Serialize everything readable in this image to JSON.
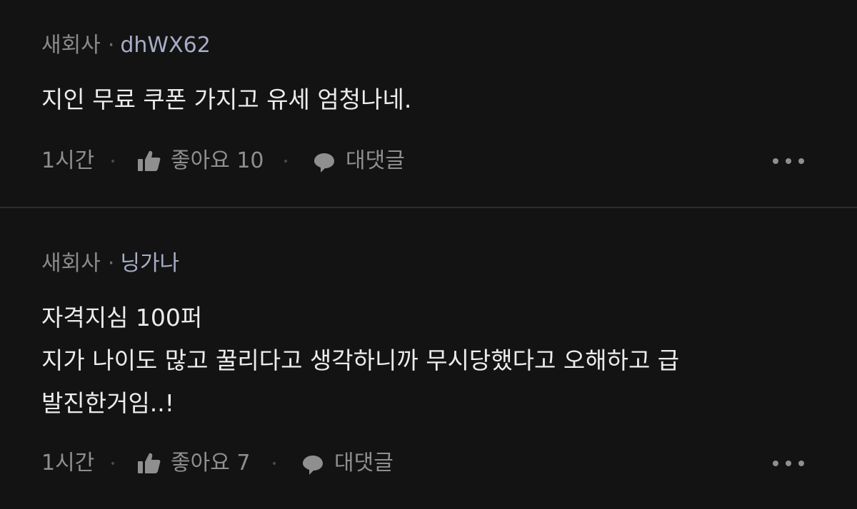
{
  "comments": [
    {
      "company": "새회사",
      "author": "dhWX62",
      "text_lines": [
        "지인 무료 쿠폰 가지고 유세 엄청나네."
      ],
      "time": "1시간",
      "like_label": "좋아요 10",
      "reply_label": "대댓글"
    },
    {
      "company": "새회사",
      "author": "닝가나",
      "text_lines": [
        "자격지심 100퍼",
        "지가 나이도 많고 꿀리다고 생각하니까 무시당했다고 오해하고 급",
        "발진한거임..!"
      ],
      "time": "1시간",
      "like_label": "좋아요 7",
      "reply_label": "대댓글"
    }
  ],
  "icons": {
    "like": "thumbs-up-icon",
    "reply": "speech-bubble-icon",
    "more": "more-dots-icon"
  },
  "colors": {
    "background": "#131313",
    "divider": "#2c2c2c",
    "author": "#a7adc7",
    "muted": "#8a8a8a",
    "text": "#ececec"
  }
}
